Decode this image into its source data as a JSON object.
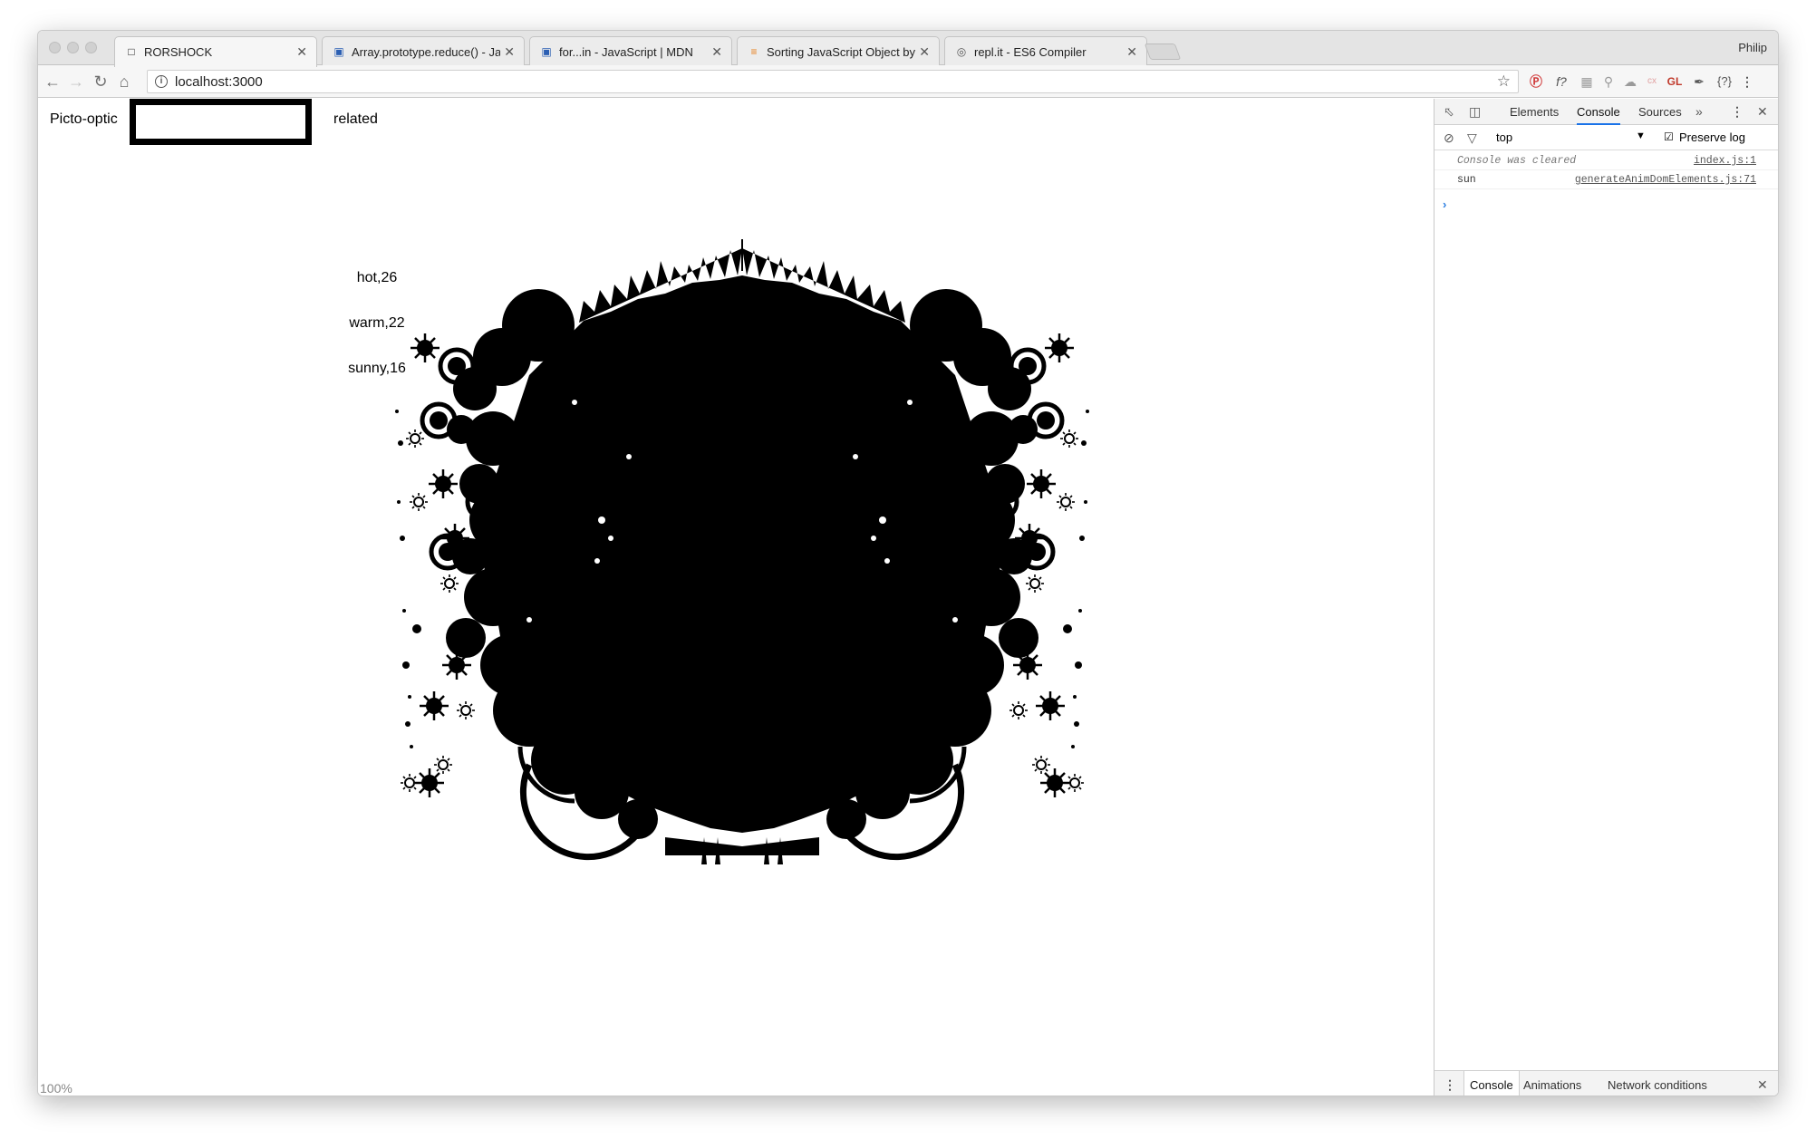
{
  "browser": {
    "profile_name": "Philip",
    "tabs": [
      {
        "title": "RORSHOCK",
        "icon": "page-icon"
      },
      {
        "title": "Array.prototype.reduce() - JavaScript | MDN",
        "icon": "mdn-icon"
      },
      {
        "title": "for...in - JavaScript | MDN",
        "icon": "mdn-icon"
      },
      {
        "title": "Sorting JavaScript Object by property value",
        "icon": "stackoverflow-icon"
      },
      {
        "title": "repl.it - ES6 Compiler",
        "icon": "replit-icon"
      }
    ],
    "url": "localhost:3000",
    "zoom": "100%"
  },
  "page": {
    "title": "Picto-optic",
    "search_value": "",
    "related_label": "related",
    "weather_list": [
      "hot,26",
      "warm,22",
      "sunny,16"
    ]
  },
  "devtools": {
    "tabs": [
      "Elements",
      "Console",
      "Sources"
    ],
    "active_tab": "Console",
    "context": "top",
    "preserve_log_label": "Preserve log",
    "preserve_log_checked": true,
    "console_messages": [
      {
        "text": "Console was cleared",
        "source": "index.js:1"
      },
      {
        "text": "sun",
        "source": "generateAnimDomElements.js:71"
      }
    ],
    "drawer_tabs": [
      "Console",
      "Animations",
      "Network conditions"
    ]
  },
  "colors": {
    "inkblot": "#000000",
    "devtools_active": "#1a73e8",
    "console_prompt": "#2a7de1"
  }
}
